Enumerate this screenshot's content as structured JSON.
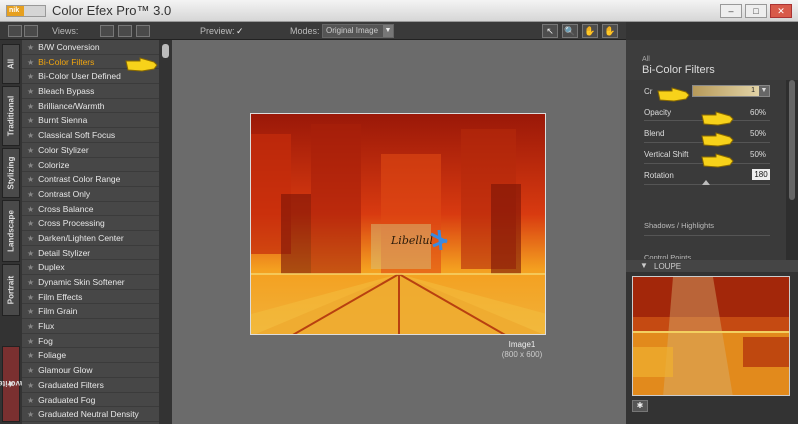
{
  "app": {
    "logo": "nik",
    "title": "Color Efex Pro™ 3.0"
  },
  "window_controls": {
    "minimize": "–",
    "maximize": "□",
    "close": "✕"
  },
  "toolbar": {
    "views_label": "Views:",
    "preview_label": "Preview:",
    "preview_check": "✓",
    "modes_label": "Modes:",
    "modes_value": "Original Image",
    "tools": [
      "↖",
      "🔍",
      "✋",
      "✋"
    ]
  },
  "vtabs": [
    "All",
    "Traditional",
    "Stylizing",
    "Landscape",
    "Portrait",
    "Favorites"
  ],
  "filters": [
    "B/W Conversion",
    "Bi-Color Filters",
    "Bi-Color User Defined",
    "Bleach Bypass",
    "Brilliance/Warmth",
    "Burnt Sienna",
    "Classical Soft Focus",
    "Color Stylizer",
    "Colorize",
    "Contrast Color Range",
    "Contrast Only",
    "Cross Balance",
    "Cross Processing",
    "Darken/Lighten Center",
    "Detail Stylizer",
    "Duplex",
    "Dynamic Skin Softener",
    "Film Effects",
    "Film Grain",
    "Flux",
    "Fog",
    "Foliage",
    "Glamour Glow",
    "Graduated Filters",
    "Graduated Fog",
    "Graduated Neutral Density"
  ],
  "selected_filter": "Bi-Color Filters",
  "preview": {
    "name": "Image1",
    "size": "(800 x 600)"
  },
  "right_panel": {
    "category": "All",
    "title": "Bi-Color Filters",
    "color_set_label": "Cr",
    "color_set_value": "1",
    "params": [
      {
        "label": "Opacity",
        "value": "60%"
      },
      {
        "label": "Blend",
        "value": "50%"
      },
      {
        "label": "Vertical Shift",
        "value": "50%"
      }
    ],
    "rotation_label": "Rotation",
    "rotation_value": "180",
    "sections": [
      "Shadows / Highlights",
      "Control Points"
    ]
  },
  "loupe": {
    "label": "LOUPE"
  },
  "colors": {
    "accent": "#f2a60f",
    "panel": "#474747",
    "background": "#6b6b6b"
  }
}
